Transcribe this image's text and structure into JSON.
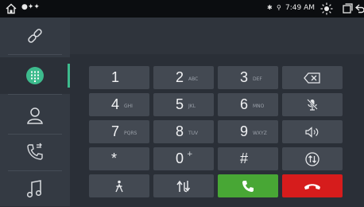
{
  "status_bar": {
    "signal_dots": "●✦✦",
    "bluetooth": "✱",
    "location": "⚲",
    "time": "7:49 AM",
    "icons": [
      "home-icon",
      "brightness-icon",
      "recent-apps-icon",
      "back-icon"
    ]
  },
  "sidebar": {
    "items": [
      {
        "name": "bluetooth-link",
        "icon": "link-icon"
      },
      {
        "name": "dialpad",
        "icon": "dialpad-icon",
        "active": true
      },
      {
        "name": "contacts",
        "icon": "contacts-icon"
      },
      {
        "name": "call-log",
        "icon": "call-log-icon"
      },
      {
        "name": "music",
        "icon": "music-icon"
      }
    ]
  },
  "dialer": {
    "number": "",
    "keys": [
      {
        "digit": "1",
        "letters": ""
      },
      {
        "digit": "2",
        "letters": "ABC"
      },
      {
        "digit": "3",
        "letters": "DEF"
      },
      {
        "digit": "4",
        "letters": "GHI"
      },
      {
        "digit": "5",
        "letters": "JKL"
      },
      {
        "digit": "6",
        "letters": "MNO"
      },
      {
        "digit": "7",
        "letters": "PQRS"
      },
      {
        "digit": "8",
        "letters": "TUV"
      },
      {
        "digit": "9",
        "letters": "WXYZ"
      },
      {
        "digit": "*",
        "letters": ""
      },
      {
        "digit": "0",
        "letters": "+"
      },
      {
        "digit": "#",
        "letters": ""
      }
    ]
  },
  "colors": {
    "accent": "#3dbb8d",
    "call": "#48a735",
    "hangup": "#d61c1c",
    "key": "#434952"
  }
}
